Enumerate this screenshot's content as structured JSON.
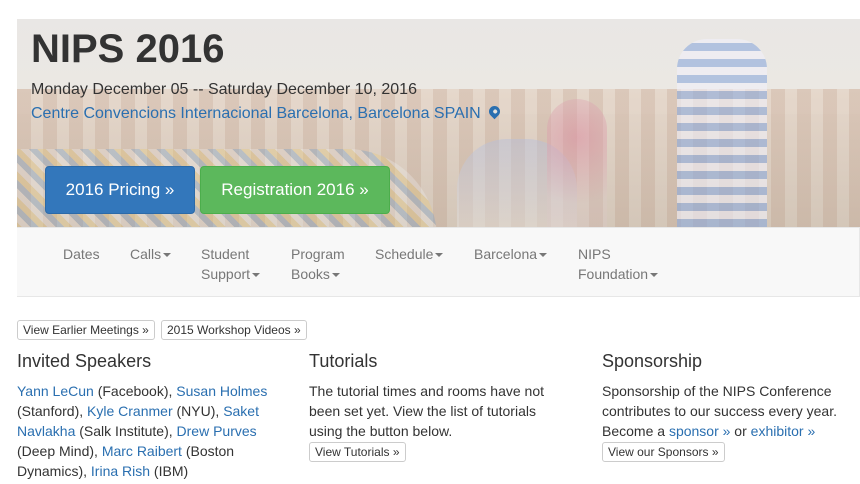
{
  "hero": {
    "title": "NIPS 2016",
    "dates": "Monday December 05 -- Saturday December 10, 2016",
    "venue": "Centre Convencions Internacional Barcelona, Barcelona SPAIN",
    "pricing_button": "2016 Pricing »",
    "registration_button": "Registration 2016 »"
  },
  "nav": {
    "items": [
      {
        "line1": "Dates",
        "line2": ""
      },
      {
        "line1": "Calls",
        "line2": ""
      },
      {
        "line1": "Student",
        "line2": "Support"
      },
      {
        "line1": "Program",
        "line2": "Books"
      },
      {
        "line1": "Schedule",
        "line2": ""
      },
      {
        "line1": "Barcelona",
        "line2": ""
      },
      {
        "line1": "NIPS",
        "line2": "Foundation"
      }
    ]
  },
  "links": {
    "earlier_meetings": "View Earlier Meetings »",
    "workshop_videos": "2015 Workshop Videos »"
  },
  "speakers": {
    "heading": "Invited Speakers",
    "list": [
      {
        "name": "Yann LeCun",
        "affil": " (Facebook), "
      },
      {
        "name": "Susan Holmes",
        "affil": " (Stanford), "
      },
      {
        "name": "Kyle Cranmer",
        "affil": " (NYU), "
      },
      {
        "name": "Saket Navlakha",
        "affil": " (Salk Institute), "
      },
      {
        "name": "Drew Purves",
        "affil": " (Deep Mind), "
      },
      {
        "name": "Marc Raibert",
        "affil": " (Boston Dynamics), "
      },
      {
        "name": "Irina Rish",
        "affil": " (IBM)"
      }
    ]
  },
  "tutorials": {
    "heading": "Tutorials",
    "text": "The tutorial times and rooms have not been set yet. View the list of tutorials using the button below.",
    "button": "View Tutorials »"
  },
  "sponsorship": {
    "heading": "Sponsorship",
    "text_before": "Sponsorship of the NIPS Conference contributes to our success every year. Become a ",
    "sponsor_link": "sponsor »",
    "middle": " or ",
    "exhibitor_link": "exhibitor »",
    "button": "View our Sponsors »"
  },
  "colors": {
    "primary": "#3377bb",
    "success": "#5cb85c",
    "link": "#2a6fb0"
  }
}
